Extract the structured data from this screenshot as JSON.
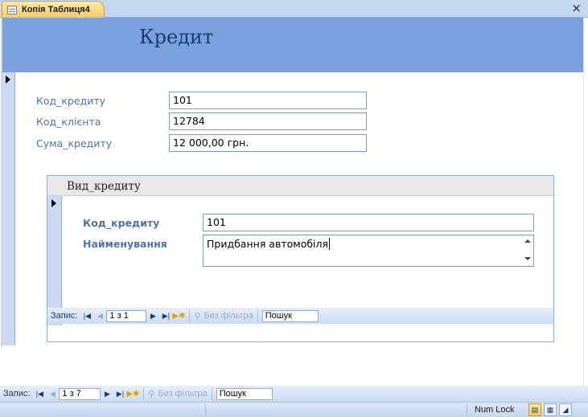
{
  "tab": {
    "title": "Копія Таблиця4",
    "close_glyph": "×"
  },
  "form": {
    "title": "Кредит",
    "fields": [
      {
        "label": "Код_кредиту",
        "value": "101"
      },
      {
        "label": "Код_клієнта",
        "value": "12784"
      },
      {
        "label": "Сума_кредиту",
        "value": "12 000,00 грн."
      }
    ]
  },
  "subform": {
    "title": "Вид_кредиту",
    "fields": [
      {
        "label": "Код_кредиту",
        "value": "101"
      },
      {
        "label": "Найменування",
        "value": "Придбання автомобіля"
      }
    ],
    "nav": {
      "label": "Запис:",
      "position": "1 з 1",
      "filter": "Без фільтра",
      "search": "Пошук"
    }
  },
  "main_nav": {
    "label": "Запис:",
    "position": "1 з 7",
    "filter": "Без фільтра",
    "search": "Пошук"
  },
  "status": {
    "numlock": "Num Lock"
  },
  "nav_glyphs": {
    "first": "|◀",
    "prev": "◀",
    "next": "▶",
    "last": "▶|",
    "new": "▶✱",
    "filter_icon": "⚲"
  },
  "view_glyphs": {
    "form": "▤",
    "layout": "▦",
    "design": "◢"
  },
  "colors": {
    "header_band": "#7aa1dd",
    "label": "#4f73a8",
    "tab": "#f8cc62"
  }
}
